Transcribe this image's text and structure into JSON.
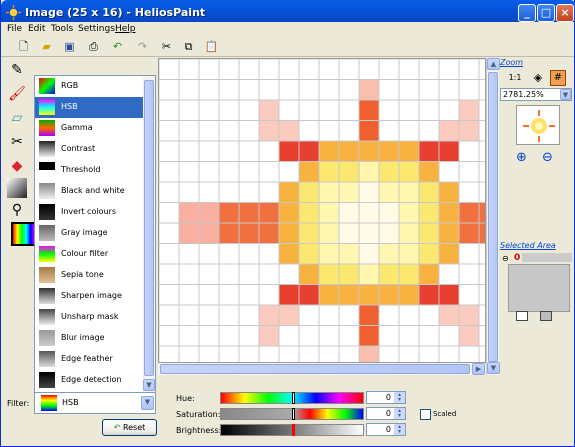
{
  "window": {
    "title": "Image (25 x 16) - HeliosPaint"
  },
  "menu": {
    "items": [
      "File",
      "Edit",
      "Tools",
      "Settings",
      "Help"
    ]
  },
  "filters": {
    "items": [
      "RGB",
      "HSB",
      "Gamma",
      "Contrast",
      "Threshold",
      "Black and white",
      "Invert colours",
      "Gray image",
      "Colour filter",
      "Sepia tone",
      "Sharpen image",
      "Unsharp mask",
      "Blur image",
      "Edge feather",
      "Edge detection"
    ],
    "selected_index": 1,
    "label": "Filter:",
    "current": "HSB",
    "reset_label": "Reset"
  },
  "adjust": {
    "hue_label": "Hue:",
    "hue_value": "0",
    "saturation_label": "Saturation:",
    "saturation_value": "0",
    "brightness_label": "Brightness:",
    "brightness_value": "0",
    "scaled_label": "Scaled"
  },
  "zoom": {
    "label": "Zoom",
    "value": "2781.25%"
  },
  "selected_area": {
    "label": "Selected Area",
    "value": "0"
  },
  "colors": {
    "title_blue": "#0a5ee8",
    "selection": "#316ac5"
  }
}
